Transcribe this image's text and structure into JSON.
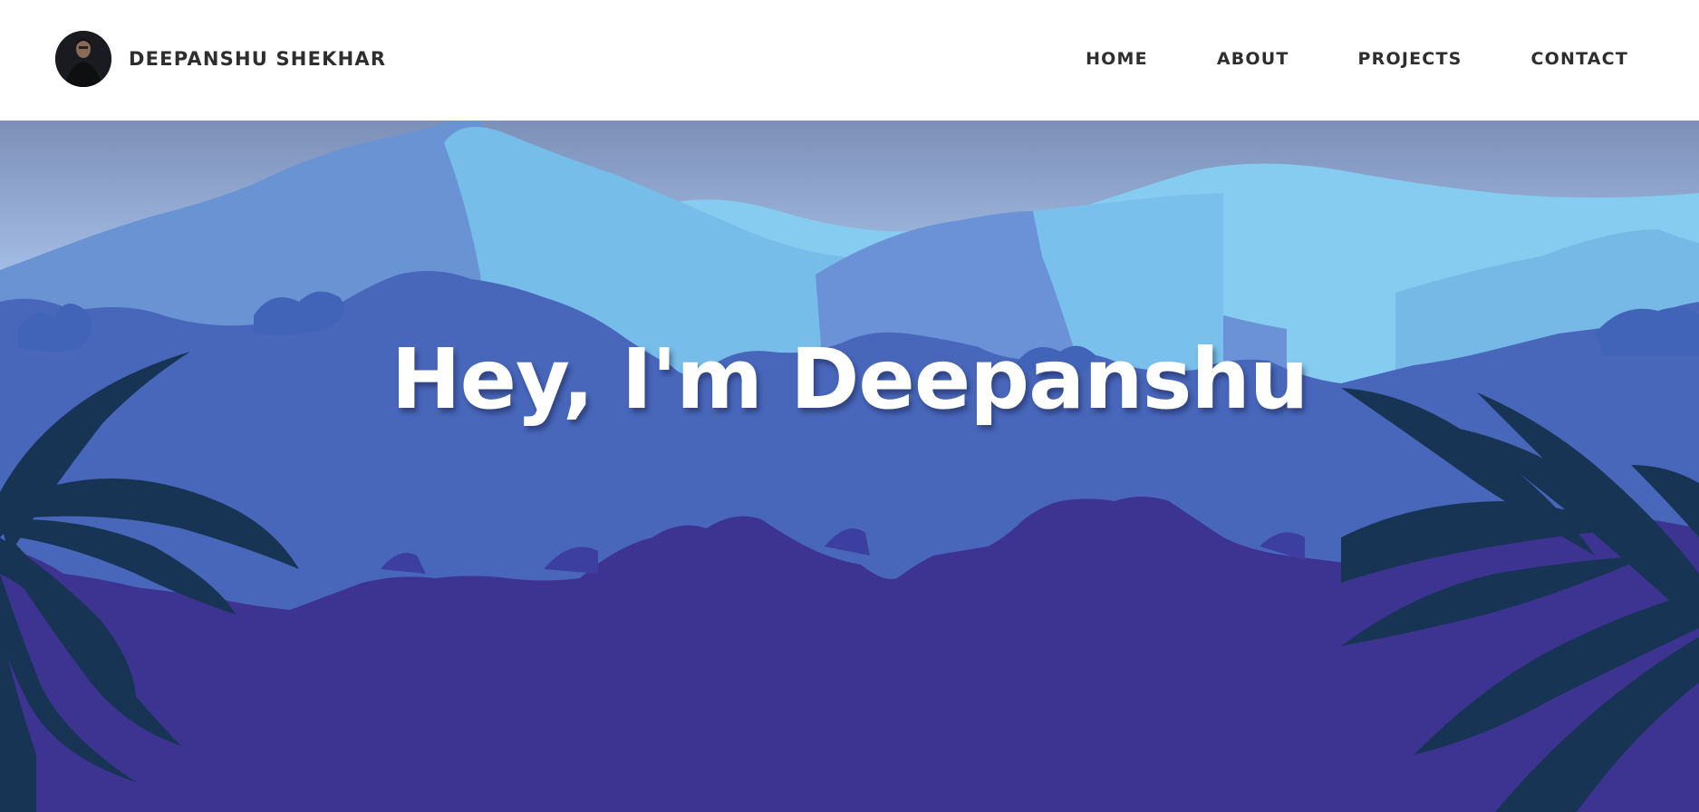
{
  "header": {
    "brand_name": "DEEPANSHU SHEKHAR",
    "avatar_icon": "person-avatar"
  },
  "nav": {
    "items": [
      {
        "label": "HOME"
      },
      {
        "label": "ABOUT"
      },
      {
        "label": "PROJECTS"
      },
      {
        "label": "CONTACT"
      }
    ]
  },
  "hero": {
    "title": "Hey, I'm Deepanshu",
    "background": "jungle-mountains-illustration"
  },
  "colors": {
    "header_bg": "#ffffff",
    "nav_text": "#2e2e2e",
    "sky_top": "#7c8fb7",
    "sky_bottom": "#a9c3ea",
    "mountain_back": "#6a93d4",
    "mountain_light": "#7dc2ea",
    "forest_mid": "#4867bb",
    "forest_front": "#3d3491",
    "leaves": "#173455",
    "title_text": "#ffffff"
  }
}
